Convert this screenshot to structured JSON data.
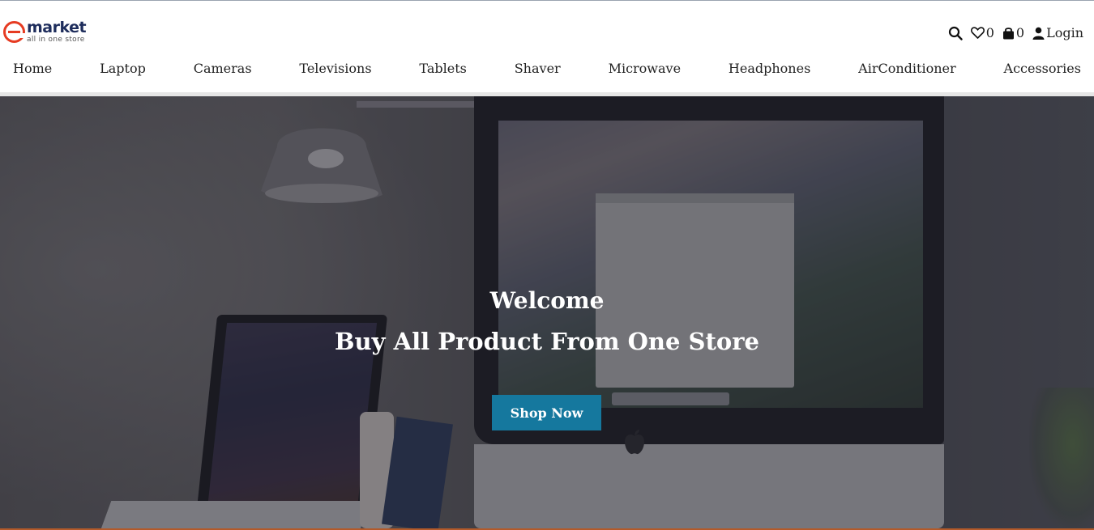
{
  "brand": {
    "name": "market",
    "tagline": "all in one store",
    "accent_color": "#e63b22",
    "name_color": "#1e2d5c"
  },
  "header": {
    "icons": {
      "search": "search-icon",
      "wishlist": "heart-icon",
      "cart": "shopping-bag-icon",
      "user": "user-icon"
    },
    "wishlist_count": "0",
    "cart_count": "0",
    "login_label": "Login"
  },
  "nav": {
    "items": [
      {
        "label": "Home"
      },
      {
        "label": "Laptop"
      },
      {
        "label": "Cameras"
      },
      {
        "label": "Televisions"
      },
      {
        "label": "Tablets"
      },
      {
        "label": "Shaver"
      },
      {
        "label": "Microwave"
      },
      {
        "label": "Headphones"
      },
      {
        "label": "AirConditioner"
      },
      {
        "label": "Accessories"
      }
    ]
  },
  "hero": {
    "title": "Welcome",
    "subtitle": "Buy All Product From One Store",
    "cta_label": "Shop Now",
    "cta_color": "#15789e"
  }
}
